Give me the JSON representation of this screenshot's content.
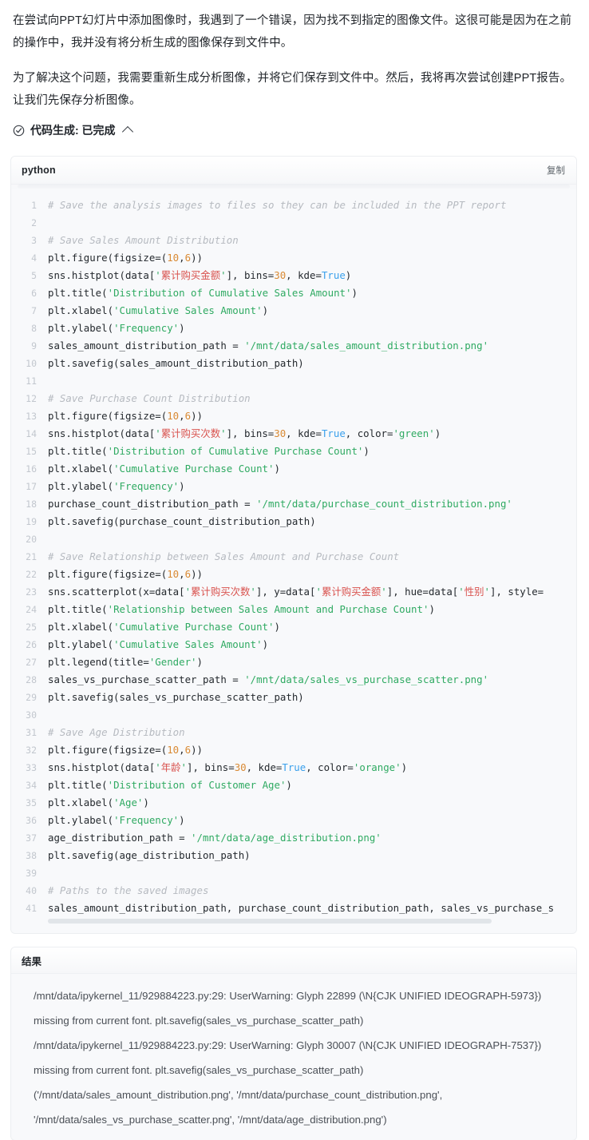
{
  "intro": {
    "paragraph1": "在尝试向PPT幻灯片中添加图像时，我遇到了一个错误，因为找不到指定的图像文件。这很可能是因为在之前的操作中，我并没有将分析生成的图像保存到文件中。",
    "paragraph2": "为了解决这个问题，我需要重新生成分析图像，并将它们保存到文件中。然后，我将再次尝试创建PPT报告。让我们先保存分析图像。"
  },
  "step_header": {
    "icon": "check-circle-icon",
    "label": "代码生成: 已完成",
    "chevron": "chevron-up-icon"
  },
  "code_block": {
    "language": "python",
    "copy_label": "复制",
    "lines": [
      {
        "n": "1",
        "tokens": [
          {
            "t": "c",
            "v": "# Save the analysis images to files so they can be included in the PPT report"
          }
        ]
      },
      {
        "n": "2",
        "tokens": []
      },
      {
        "n": "3",
        "tokens": [
          {
            "t": "c",
            "v": "# Save Sales Amount Distribution"
          }
        ]
      },
      {
        "n": "4",
        "tokens": [
          {
            "t": "p",
            "v": "plt.figure(figsize=("
          },
          {
            "t": "n",
            "v": "10"
          },
          {
            "t": "p",
            "v": ","
          },
          {
            "t": "n",
            "v": "6"
          },
          {
            "t": "p",
            "v": "))"
          }
        ]
      },
      {
        "n": "5",
        "tokens": [
          {
            "t": "p",
            "v": "sns.histplot(data["
          },
          {
            "t": "s",
            "v": "'"
          },
          {
            "t": "sz",
            "v": "累计购买金额"
          },
          {
            "t": "s",
            "v": "'"
          },
          {
            "t": "p",
            "v": "], bins="
          },
          {
            "t": "n",
            "v": "30"
          },
          {
            "t": "p",
            "v": ", kde="
          },
          {
            "t": "k",
            "v": "True"
          },
          {
            "t": "p",
            "v": ")"
          }
        ]
      },
      {
        "n": "6",
        "tokens": [
          {
            "t": "p",
            "v": "plt.title("
          },
          {
            "t": "s",
            "v": "'Distribution of Cumulative Sales Amount'"
          },
          {
            "t": "p",
            "v": ")"
          }
        ]
      },
      {
        "n": "7",
        "tokens": [
          {
            "t": "p",
            "v": "plt.xlabel("
          },
          {
            "t": "s",
            "v": "'Cumulative Sales Amount'"
          },
          {
            "t": "p",
            "v": ")"
          }
        ]
      },
      {
        "n": "8",
        "tokens": [
          {
            "t": "p",
            "v": "plt.ylabel("
          },
          {
            "t": "s",
            "v": "'Frequency'"
          },
          {
            "t": "p",
            "v": ")"
          }
        ]
      },
      {
        "n": "9",
        "tokens": [
          {
            "t": "p",
            "v": "sales_amount_distribution_path = "
          },
          {
            "t": "s",
            "v": "'/mnt/data/sales_amount_distribution.png'"
          }
        ]
      },
      {
        "n": "10",
        "tokens": [
          {
            "t": "p",
            "v": "plt.savefig(sales_amount_distribution_path)"
          }
        ]
      },
      {
        "n": "11",
        "tokens": []
      },
      {
        "n": "12",
        "tokens": [
          {
            "t": "c",
            "v": "# Save Purchase Count Distribution"
          }
        ]
      },
      {
        "n": "13",
        "tokens": [
          {
            "t": "p",
            "v": "plt.figure(figsize=("
          },
          {
            "t": "n",
            "v": "10"
          },
          {
            "t": "p",
            "v": ","
          },
          {
            "t": "n",
            "v": "6"
          },
          {
            "t": "p",
            "v": "))"
          }
        ]
      },
      {
        "n": "14",
        "tokens": [
          {
            "t": "p",
            "v": "sns.histplot(data["
          },
          {
            "t": "s",
            "v": "'"
          },
          {
            "t": "sz",
            "v": "累计购买次数"
          },
          {
            "t": "s",
            "v": "'"
          },
          {
            "t": "p",
            "v": "], bins="
          },
          {
            "t": "n",
            "v": "30"
          },
          {
            "t": "p",
            "v": ", kde="
          },
          {
            "t": "k",
            "v": "True"
          },
          {
            "t": "p",
            "v": ", color="
          },
          {
            "t": "s",
            "v": "'green'"
          },
          {
            "t": "p",
            "v": ")"
          }
        ]
      },
      {
        "n": "15",
        "tokens": [
          {
            "t": "p",
            "v": "plt.title("
          },
          {
            "t": "s",
            "v": "'Distribution of Cumulative Purchase Count'"
          },
          {
            "t": "p",
            "v": ")"
          }
        ]
      },
      {
        "n": "16",
        "tokens": [
          {
            "t": "p",
            "v": "plt.xlabel("
          },
          {
            "t": "s",
            "v": "'Cumulative Purchase Count'"
          },
          {
            "t": "p",
            "v": ")"
          }
        ]
      },
      {
        "n": "17",
        "tokens": [
          {
            "t": "p",
            "v": "plt.ylabel("
          },
          {
            "t": "s",
            "v": "'Frequency'"
          },
          {
            "t": "p",
            "v": ")"
          }
        ]
      },
      {
        "n": "18",
        "tokens": [
          {
            "t": "p",
            "v": "purchase_count_distribution_path = "
          },
          {
            "t": "s",
            "v": "'/mnt/data/purchase_count_distribution.png'"
          }
        ]
      },
      {
        "n": "19",
        "tokens": [
          {
            "t": "p",
            "v": "plt.savefig(purchase_count_distribution_path)"
          }
        ]
      },
      {
        "n": "20",
        "tokens": []
      },
      {
        "n": "21",
        "tokens": [
          {
            "t": "c",
            "v": "# Save Relationship between Sales Amount and Purchase Count"
          }
        ]
      },
      {
        "n": "22",
        "tokens": [
          {
            "t": "p",
            "v": "plt.figure(figsize=("
          },
          {
            "t": "n",
            "v": "10"
          },
          {
            "t": "p",
            "v": ","
          },
          {
            "t": "n",
            "v": "6"
          },
          {
            "t": "p",
            "v": "))"
          }
        ]
      },
      {
        "n": "23",
        "tokens": [
          {
            "t": "p",
            "v": "sns.scatterplot(x=data["
          },
          {
            "t": "s",
            "v": "'"
          },
          {
            "t": "sz",
            "v": "累计购买次数"
          },
          {
            "t": "s",
            "v": "'"
          },
          {
            "t": "p",
            "v": "], y=data["
          },
          {
            "t": "s",
            "v": "'"
          },
          {
            "t": "sz",
            "v": "累计购买金额"
          },
          {
            "t": "s",
            "v": "'"
          },
          {
            "t": "p",
            "v": "], hue=data["
          },
          {
            "t": "s",
            "v": "'"
          },
          {
            "t": "sz",
            "v": "性别"
          },
          {
            "t": "s",
            "v": "'"
          },
          {
            "t": "p",
            "v": "], style="
          }
        ]
      },
      {
        "n": "24",
        "tokens": [
          {
            "t": "p",
            "v": "plt.title("
          },
          {
            "t": "s",
            "v": "'Relationship between Sales Amount and Purchase Count'"
          },
          {
            "t": "p",
            "v": ")"
          }
        ]
      },
      {
        "n": "25",
        "tokens": [
          {
            "t": "p",
            "v": "plt.xlabel("
          },
          {
            "t": "s",
            "v": "'Cumulative Purchase Count'"
          },
          {
            "t": "p",
            "v": ")"
          }
        ]
      },
      {
        "n": "26",
        "tokens": [
          {
            "t": "p",
            "v": "plt.ylabel("
          },
          {
            "t": "s",
            "v": "'Cumulative Sales Amount'"
          },
          {
            "t": "p",
            "v": ")"
          }
        ]
      },
      {
        "n": "27",
        "tokens": [
          {
            "t": "p",
            "v": "plt.legend(title="
          },
          {
            "t": "s",
            "v": "'Gender'"
          },
          {
            "t": "p",
            "v": ")"
          }
        ]
      },
      {
        "n": "28",
        "tokens": [
          {
            "t": "p",
            "v": "sales_vs_purchase_scatter_path = "
          },
          {
            "t": "s",
            "v": "'/mnt/data/sales_vs_purchase_scatter.png'"
          }
        ]
      },
      {
        "n": "29",
        "tokens": [
          {
            "t": "p",
            "v": "plt.savefig(sales_vs_purchase_scatter_path)"
          }
        ]
      },
      {
        "n": "30",
        "tokens": []
      },
      {
        "n": "31",
        "tokens": [
          {
            "t": "c",
            "v": "# Save Age Distribution"
          }
        ]
      },
      {
        "n": "32",
        "tokens": [
          {
            "t": "p",
            "v": "plt.figure(figsize=("
          },
          {
            "t": "n",
            "v": "10"
          },
          {
            "t": "p",
            "v": ","
          },
          {
            "t": "n",
            "v": "6"
          },
          {
            "t": "p",
            "v": "))"
          }
        ]
      },
      {
        "n": "33",
        "tokens": [
          {
            "t": "p",
            "v": "sns.histplot(data["
          },
          {
            "t": "s",
            "v": "'"
          },
          {
            "t": "sz",
            "v": "年龄"
          },
          {
            "t": "s",
            "v": "'"
          },
          {
            "t": "p",
            "v": "], bins="
          },
          {
            "t": "n",
            "v": "30"
          },
          {
            "t": "p",
            "v": ", kde="
          },
          {
            "t": "k",
            "v": "True"
          },
          {
            "t": "p",
            "v": ", color="
          },
          {
            "t": "s",
            "v": "'orange'"
          },
          {
            "t": "p",
            "v": ")"
          }
        ]
      },
      {
        "n": "34",
        "tokens": [
          {
            "t": "p",
            "v": "plt.title("
          },
          {
            "t": "s",
            "v": "'Distribution of Customer Age'"
          },
          {
            "t": "p",
            "v": ")"
          }
        ]
      },
      {
        "n": "35",
        "tokens": [
          {
            "t": "p",
            "v": "plt.xlabel("
          },
          {
            "t": "s",
            "v": "'Age'"
          },
          {
            "t": "p",
            "v": ")"
          }
        ]
      },
      {
        "n": "36",
        "tokens": [
          {
            "t": "p",
            "v": "plt.ylabel("
          },
          {
            "t": "s",
            "v": "'Frequency'"
          },
          {
            "t": "p",
            "v": ")"
          }
        ]
      },
      {
        "n": "37",
        "tokens": [
          {
            "t": "p",
            "v": "age_distribution_path = "
          },
          {
            "t": "s",
            "v": "'/mnt/data/age_distribution.png'"
          }
        ]
      },
      {
        "n": "38",
        "tokens": [
          {
            "t": "p",
            "v": "plt.savefig(age_distribution_path)"
          }
        ]
      },
      {
        "n": "39",
        "tokens": []
      },
      {
        "n": "40",
        "tokens": [
          {
            "t": "c",
            "v": "# Paths to the saved images"
          }
        ]
      },
      {
        "n": "41",
        "tokens": [
          {
            "t": "p",
            "v": "sales_amount_distribution_path, purchase_count_distribution_path, sales_vs_purchase_s"
          }
        ]
      }
    ]
  },
  "result_block": {
    "title": "结果",
    "lines": [
      "/mnt/data/ipykernel_11/929884223.py:29: UserWarning: Glyph 22899 (\\N{CJK UNIFIED IDEOGRAPH-5973}) missing from current font. plt.savefig(sales_vs_purchase_scatter_path)",
      "/mnt/data/ipykernel_11/929884223.py:29: UserWarning: Glyph 30007 (\\N{CJK UNIFIED IDEOGRAPH-7537}) missing from current font. plt.savefig(sales_vs_purchase_scatter_path)",
      "('/mnt/data/sales_amount_distribution.png', '/mnt/data/purchase_count_distribution.png', '/mnt/data/sales_vs_purchase_scatter.png', '/mnt/data/age_distribution.png')"
    ]
  }
}
